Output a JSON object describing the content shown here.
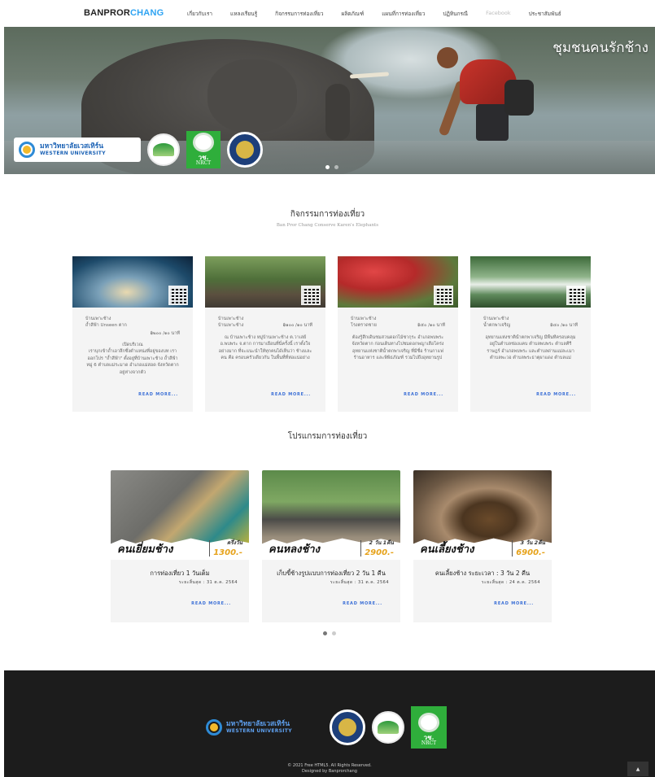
{
  "nav": {
    "logo_main": "BANPROR",
    "logo_accent": "CHANG",
    "links": [
      "เกี่ยวกับเรา",
      "แหลงเรียนรู้",
      "กิจกรรมการท่องเที่ยว",
      "ผลิตภัณฑ์",
      "แผนที่การท่องเที่ยว",
      "ปฏิทินกรณี",
      "Facebook",
      "ประชาสัมพันธ์"
    ]
  },
  "hero": {
    "title": "ชุมชนคนรักช้าง",
    "logo_th": "มหาวิทยาลัยเวสเทิร์น",
    "logo_en": "WESTERN UNIVERSITY",
    "nrct_th": "วช.",
    "nrct_en": "NRCT"
  },
  "activities": {
    "title": "กิจกรรมการท่องเที่ยว",
    "subtitle": "Ban Pror Chang Conserve Karen's Elephants",
    "read_more": "READ MORE...",
    "items": [
      {
        "loc1": "บ้านเพาะช้าง",
        "loc2": "ถ้ำสีฟ้า Unseen ตาก",
        "dist": "",
        "time": "฿๒๐๐ /๑๐ นาที",
        "desc_lead": "เปิดบริเวณ",
        "desc": "เราบุกเข้าถ้ำเอาลึกซึ่งตำแหน่งที่อยู่ของบท เราออกโปร \"ถ้ำสีฟ้า\" ตั้งอยู่ที่บ้านเพาะช้าง ถ้ำสีฟ้า หมู่ 6 ตำบลแม่ระมาด อำเภอแม่สอด จังหวัดตาก อยู่ห่างจากตัว"
      },
      {
        "loc1": "บ้านเพาะช้าง",
        "loc2": "บ้านเพาะช้าง",
        "dist": "฿๑๐๐ /๑๐ นาที",
        "time": "",
        "desc_lead": "",
        "desc": "ณ บ้านเพาะช้าง หมู่บ้านเพาะช้าง ต.วาเล่ย์ อ.พบพระ จ.ตาก การมาเยือนที่นี่ครั้งนี้ เราตั้งใจอย่างมาก ที่จะแนะนำให้ทุกคนได้เห็นว่า ช้างและคน คือ ครอบครัวเดียวกัน ในพื้นที่ที่ห่อแน่อย่าง"
      },
      {
        "loc1": "บ้านเพาะช้าง",
        "loc2": "โรงตราดชาย",
        "dist": "฿๕๐ /๑๐ นาที",
        "time": "",
        "desc_lead": "",
        "desc": "ต้องรู้สึกเดินชมสวนดอกไม้ซากุระ อำเภอพบพระ จังหวัดตาก ก่อนเดินทางไปชมดอกพญาเสือโคร่ง อุทยานแห่งชาติน้ำตกพาเจริญ ที่มีชื่อ ร้านกาแฟ ร้านอาหาร และพิพิธภัณฑ์ รวมไปถึงอุทยานรูป"
      },
      {
        "loc1": "บ้านเพาะช้าง",
        "loc2": "น้ำตกพาเจริญ",
        "dist": "฿๔๐ /๑๐ นาที",
        "time": "",
        "desc_lead": "",
        "desc": "อุทยานแห่งชาติน้ำตกพาเจริญ มีพื้นที่ครอบคลุมอยู่ในตำบลช่องแคบ ตำบลพบพระ ตำบลคีรีราษฎร์ อำเภอพบพระ และตำบลด่านแม่ละเมา ตำบลพะวอ ตำบลพระธาตุผาแดง ตำบลแม่"
      }
    ]
  },
  "programs": {
    "title": "โปรแกรมการท่องเที่ยว",
    "read_more": "READ MORE...",
    "items": [
      {
        "name": "คนเยี่ยมช้าง",
        "duration": "ครึ่งวัน",
        "price": "1300.-",
        "title": "การท่องเที่ยว 1 วันเต็ม",
        "date": "ระยะสิ้นสุด : 31 ต.ค. 2564"
      },
      {
        "name": "คนหลงช้าง",
        "duration": "2 วัน 1คืน",
        "price": "2900.-",
        "title": "เก็บขี้ช้างรูปแบบการท่องเที่ยว 2 วัน 1 คืน",
        "date": "ระยะสิ้นสุด : 31 ต.ค. 2564"
      },
      {
        "name": "คนเลี้ยงช้าง",
        "duration": "3 วัน 2คืน",
        "price": "6900.-",
        "title": "คนเลี้ยงช้าง ระยะเวลา : 3 วัน 2 คืน",
        "date": "ระยะสิ้นสุด : 24 ต.ค. 2564"
      }
    ]
  },
  "footer": {
    "logo_th": "มหาวิทยาลัยเวสเทิร์น",
    "logo_en": "WESTERN UNIVERSITY",
    "nrct_th": "วช.",
    "nrct_en": "NRCT",
    "copyright": "© 2021 Free HTML5. All Rights Reserved.",
    "designed": "Designed by Banprorchang",
    "to_top": "▲"
  }
}
